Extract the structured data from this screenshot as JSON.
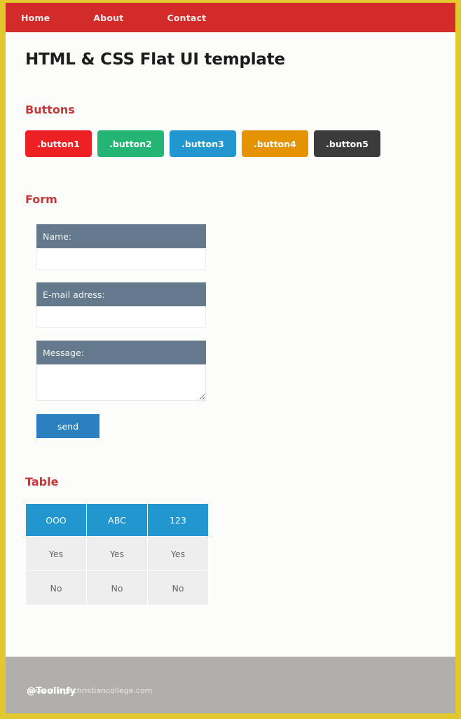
{
  "nav": {
    "items": [
      {
        "label": "Home"
      },
      {
        "label": "About"
      },
      {
        "label": "Contact"
      }
    ]
  },
  "page": {
    "title": "HTML & CSS Flat UI template"
  },
  "sections": {
    "buttons_heading": "Buttons",
    "form_heading": "Form",
    "table_heading": "Table"
  },
  "buttons": [
    {
      "label": ".button1",
      "color": "#ed2024"
    },
    {
      "label": ".button2",
      "color": "#22b573"
    },
    {
      "label": ".button3",
      "color": "#2196cf"
    },
    {
      "label": ".button4",
      "color": "#e59400"
    },
    {
      "label": ".button5",
      "color": "#3b3b3b"
    }
  ],
  "form": {
    "name_label": "Name:",
    "name_value": "",
    "name_placeholder": "",
    "email_label": "E-mail adress:",
    "email_value": "",
    "email_placeholder": "",
    "message_label": "Message:",
    "message_value": "",
    "message_placeholder": "",
    "send_label": "send"
  },
  "table": {
    "headers": [
      "OOO",
      "ABC",
      "123"
    ],
    "rows": [
      [
        "Yes",
        "Yes",
        "Yes"
      ],
      [
        "No",
        "No",
        "No"
      ]
    ]
  },
  "footer": {
    "url": "www.villagechristiancollege.com",
    "watermark": "@Toolinfy"
  },
  "theme": {
    "border": "#e3c72f",
    "navbar": "#d32a2a",
    "heading": "#c33a3a",
    "label": "#64798c",
    "table_header": "#2196cf",
    "send": "#2c80c0",
    "footer": "#b0afad"
  }
}
